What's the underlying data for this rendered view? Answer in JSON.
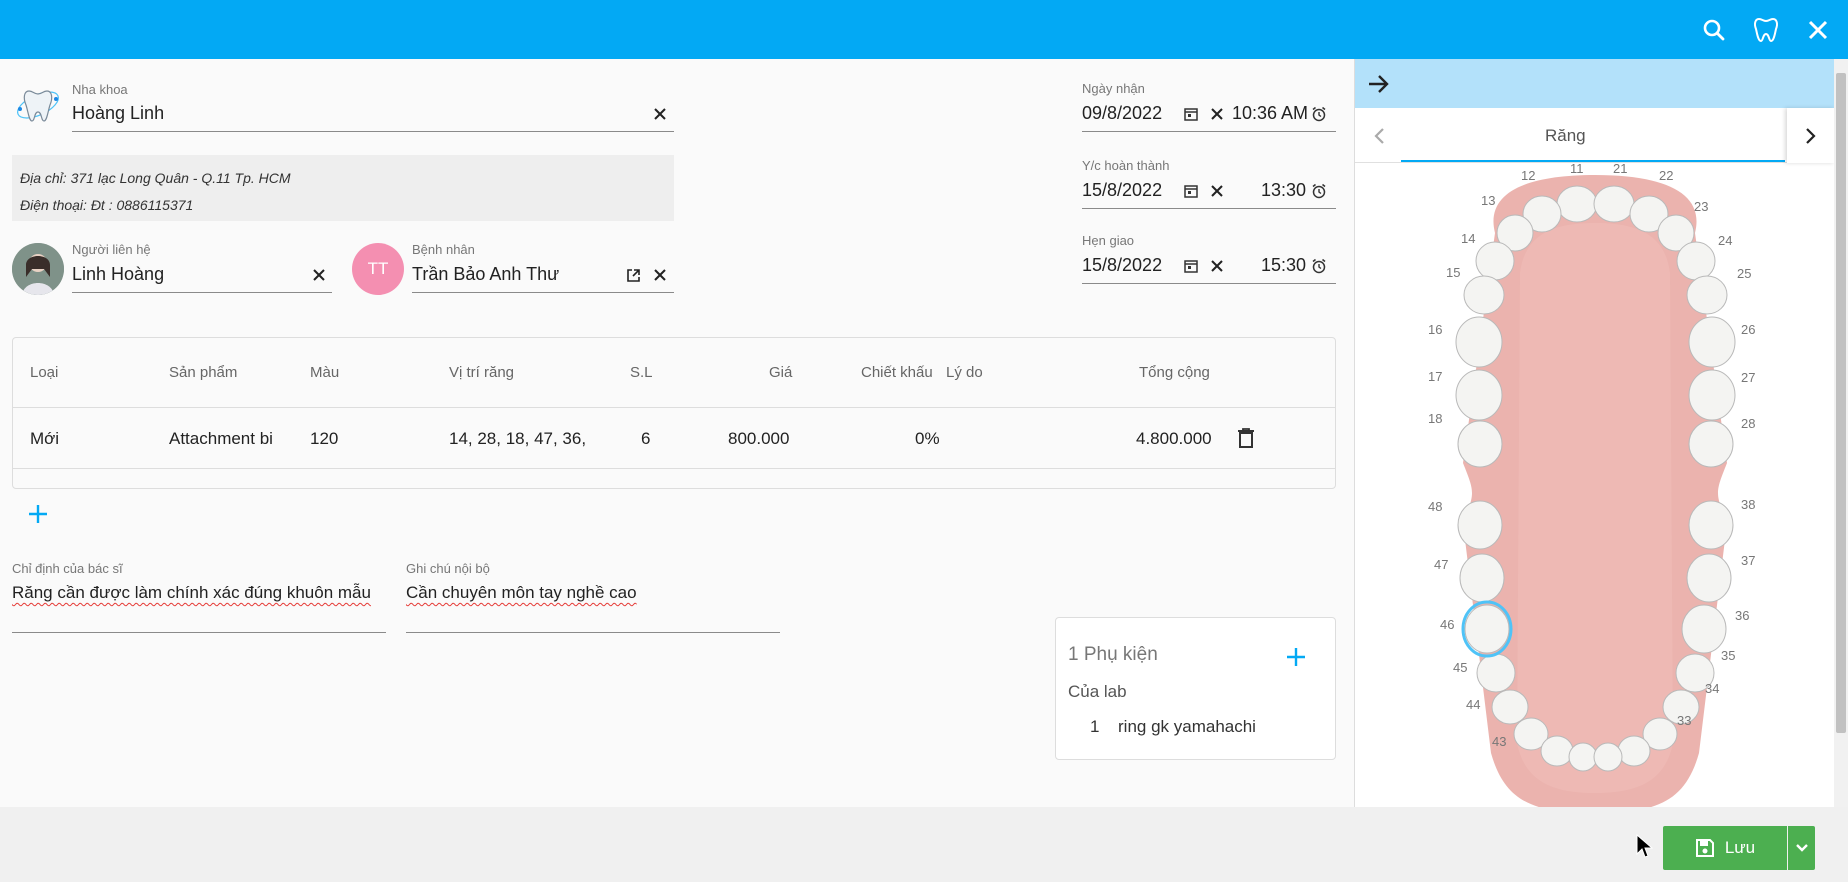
{
  "clinic": {
    "label": "Nha khoa",
    "value": "Hoàng Linh"
  },
  "address": {
    "line1": "Địa chỉ: 371 lạc Long Quân - Q.11 Tp. HCM",
    "line2": "Điện thoại: Đt : 0886115371"
  },
  "contact": {
    "label": "Người liên hệ",
    "value": "Linh Hoàng"
  },
  "patient": {
    "label": "Bệnh nhân",
    "value": "Trần Bảo Anh Thư",
    "initials": "TT",
    "avatar_color": "#f06292"
  },
  "dates": [
    {
      "label": "Ngày nhận",
      "date": "09/8/2022",
      "time": "10:36 AM"
    },
    {
      "label": "Y/c hoàn thành",
      "date": "15/8/2022",
      "time": "13:30"
    },
    {
      "label": "Hẹn giao",
      "date": "15/8/2022",
      "time": "15:30"
    }
  ],
  "table": {
    "headers": [
      "Loại",
      "Sản phẩm",
      "Màu",
      "Vị trí răng",
      "S.L",
      "Giá",
      "Chiết khấu",
      "Lý do",
      "Tổng cộng"
    ],
    "rows": [
      {
        "type": "Mới",
        "product": "Attachment bi",
        "color": "120",
        "teeth": "14, 28, 18, 47, 36,",
        "qty": "6",
        "price": "800.000",
        "discount": "0%",
        "reason": "",
        "total": "4.800.000"
      }
    ]
  },
  "notes": {
    "doctor_label": "Chỉ định của bác sĩ",
    "doctor_value": "Răng cần được làm chính xác đúng khuôn mẫu",
    "internal_label": "Ghi chú nội bộ",
    "internal_value": "Cần chuyên môn tay nghề cao"
  },
  "accessory": {
    "title": "1 Phụ kiện",
    "subtitle": "Của lab",
    "items": [
      {
        "qty": "1",
        "name": "ring gk yamahachi"
      }
    ]
  },
  "panel": {
    "tab_label": "Răng",
    "upper_numbers": [
      "11",
      "12",
      "13",
      "14",
      "15",
      "16",
      "17",
      "18",
      "21",
      "22",
      "23",
      "24",
      "25",
      "26",
      "27",
      "28"
    ],
    "lower_numbers": [
      "48",
      "47",
      "46",
      "45",
      "44",
      "43",
      "38",
      "37",
      "36",
      "35",
      "34",
      "33"
    ]
  },
  "save": {
    "label": "Lưu"
  },
  "colors": {
    "primary": "#03a9f4",
    "save": "#4caf50",
    "panel_head": "#b3e1fa",
    "gum": "#e8a6a0"
  }
}
